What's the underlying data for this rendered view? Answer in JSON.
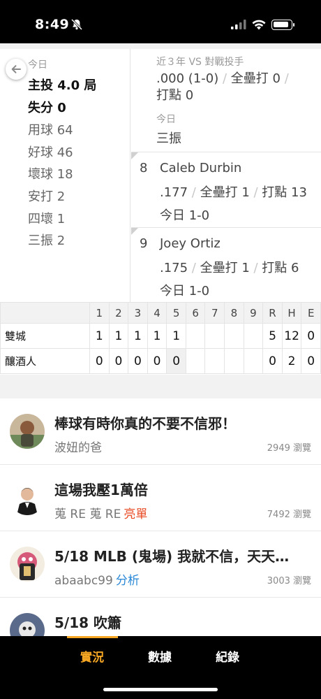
{
  "status_bar": {
    "time": "8:49"
  },
  "pitcher_today": {
    "label": "今日",
    "innings": "主投 4.0 局",
    "runs": "失分 0",
    "pitches": "用球 64",
    "strikes": "好球 46",
    "balls": "壞球 18",
    "hits": "安打 2",
    "walks": "四壞 1",
    "strikeouts": "三振 2"
  },
  "vs_batter": {
    "label": "近３年 VS 對戰投手",
    "avg": ".000 (1-0)",
    "hr": "全壘打 0",
    "rbi": "打點 0",
    "today_label": "今日",
    "today_result": "三振"
  },
  "batters": [
    {
      "order": "8",
      "name": "Caleb Durbin",
      "avg": ".177",
      "hr": "全壘打 1",
      "rbi": "打點 13",
      "today": "今日 1-0"
    },
    {
      "order": "9",
      "name": "Joey Ortiz",
      "avg": ".175",
      "hr": "全壘打 1",
      "rbi": "打點 6",
      "today": "今日 1-0"
    }
  ],
  "scoreboard": {
    "headers": [
      "1",
      "2",
      "3",
      "4",
      "5",
      "6",
      "7",
      "8",
      "9",
      "R",
      "H",
      "E"
    ],
    "teams": [
      {
        "name": "雙城",
        "innings": [
          "1",
          "1",
          "1",
          "1",
          "1",
          "",
          "",
          "",
          ""
        ],
        "r": "5",
        "h": "12",
        "e": "0"
      },
      {
        "name": "釀酒人",
        "innings": [
          "0",
          "0",
          "0",
          "0",
          "0",
          "",
          "",
          "",
          ""
        ],
        "r": "0",
        "h": "2",
        "e": "0"
      }
    ]
  },
  "articles": [
    {
      "title": "棒球有時你真的不要不信邪！",
      "author": "波妞的爸",
      "tag": "",
      "views": "2949 瀏覽"
    },
    {
      "title": "這場我壓1萬倍",
      "author": "蒐 RE 蒐 RE",
      "tag": "亮單",
      "tag_color": "#e84a22",
      "views": "7492 瀏覽"
    },
    {
      "title": "5/18 MLB (鬼場) 我就不信，天天…",
      "author": "abaabc99",
      "tag": "分析",
      "tag_color": "#2a88d6",
      "views": "3003 瀏覽"
    },
    {
      "title": "5/18 吹簫",
      "author": "",
      "tag": "",
      "views": ""
    }
  ],
  "tabs": [
    {
      "label": "實況",
      "active": true
    },
    {
      "label": "數據",
      "active": false
    },
    {
      "label": "紀錄",
      "active": false
    }
  ],
  "colors": {
    "accent": "#f5a623",
    "tag_red": "#e84a22",
    "tag_blue": "#2a88d6"
  }
}
